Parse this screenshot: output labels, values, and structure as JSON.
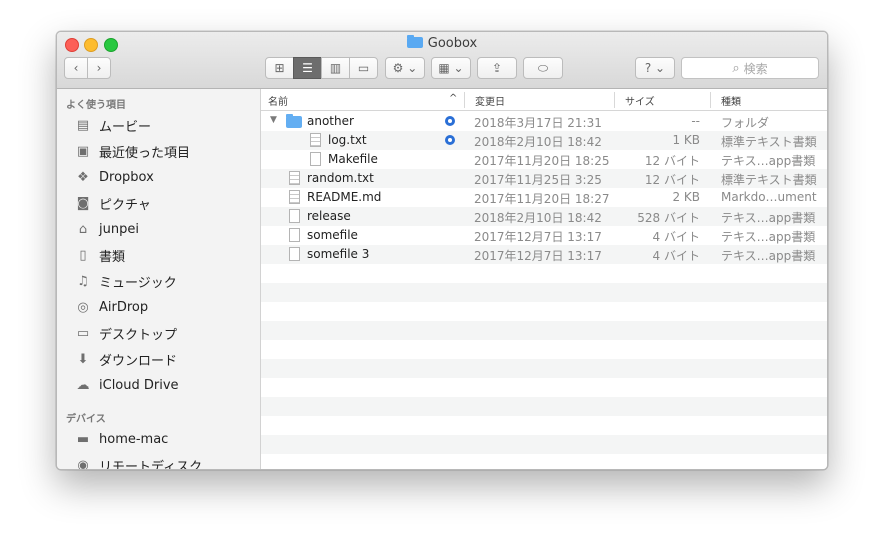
{
  "window": {
    "title": "Goobox"
  },
  "toolbar": {
    "back": "‹",
    "forward": "›",
    "view_icons": "⊞",
    "view_list": "☰",
    "view_columns": "▥",
    "view_coverflow": "▭",
    "action": "⚙ ⌄",
    "arrange": "▦ ⌄",
    "share": "⇪",
    "tag": "⬭",
    "help": "? ⌄",
    "search_placeholder": "検索"
  },
  "sidebar": {
    "favorites_header": "よく使う項目",
    "favorites": [
      {
        "label": "ムービー",
        "icon": "film-icon"
      },
      {
        "label": "最近使った項目",
        "icon": "recents-icon"
      },
      {
        "label": "Dropbox",
        "icon": "dropbox-icon"
      },
      {
        "label": "ピクチャ",
        "icon": "camera-icon"
      },
      {
        "label": "junpei",
        "icon": "home-icon"
      },
      {
        "label": "書類",
        "icon": "documents-icon"
      },
      {
        "label": "ミュージック",
        "icon": "music-icon"
      },
      {
        "label": "AirDrop",
        "icon": "airdrop-icon"
      },
      {
        "label": "デスクトップ",
        "icon": "desktop-icon"
      },
      {
        "label": "ダウンロード",
        "icon": "download-icon"
      },
      {
        "label": "iCloud Drive",
        "icon": "cloud-icon"
      }
    ],
    "devices_header": "デバイス",
    "devices": [
      {
        "label": "home-mac",
        "icon": "hard-drive-icon"
      },
      {
        "label": "リモートディスク",
        "icon": "disc-icon"
      }
    ]
  },
  "columns": {
    "name": "名前",
    "date": "変更日",
    "size": "サイズ",
    "kind": "種類",
    "sort_indicator": "^"
  },
  "files": [
    {
      "name": "another",
      "date": "2018年3月17日 21:31",
      "size": "--",
      "kind": "フォルダ",
      "type": "folder",
      "indent": 0,
      "synced": true
    },
    {
      "name": "log.txt",
      "date": "2018年2月10日 18:42",
      "size": "1 KB",
      "kind": "標準テキスト書類",
      "type": "text",
      "indent": 1,
      "synced": true
    },
    {
      "name": "Makefile",
      "date": "2017年11月20日 18:25",
      "size": "12 バイト",
      "kind": "テキス…app書類",
      "type": "blank",
      "indent": 1,
      "synced": false
    },
    {
      "name": "random.txt",
      "date": "2017年11月25日 3:25",
      "size": "12 バイト",
      "kind": "標準テキスト書類",
      "type": "text",
      "indent": 0,
      "synced": false
    },
    {
      "name": "README.md",
      "date": "2017年11月20日 18:27",
      "size": "2 KB",
      "kind": "Markdo…ument",
      "type": "text",
      "indent": 0,
      "synced": false
    },
    {
      "name": "release",
      "date": "2018年2月10日 18:42",
      "size": "528 バイト",
      "kind": "テキス…app書類",
      "type": "blank",
      "indent": 0,
      "synced": false
    },
    {
      "name": "somefile",
      "date": "2017年12月7日 13:17",
      "size": "4 バイト",
      "kind": "テキス…app書類",
      "type": "blank",
      "indent": 0,
      "synced": false
    },
    {
      "name": "somefile 3",
      "date": "2017年12月7日 13:17",
      "size": "4 バイト",
      "kind": "テキス…app書類",
      "type": "blank",
      "indent": 0,
      "synced": false
    }
  ],
  "disclosure_open": "▼",
  "colors": {
    "folder": "#63aef2",
    "sync": "#2a6fd6",
    "row_alt": "#f4f5f5"
  }
}
